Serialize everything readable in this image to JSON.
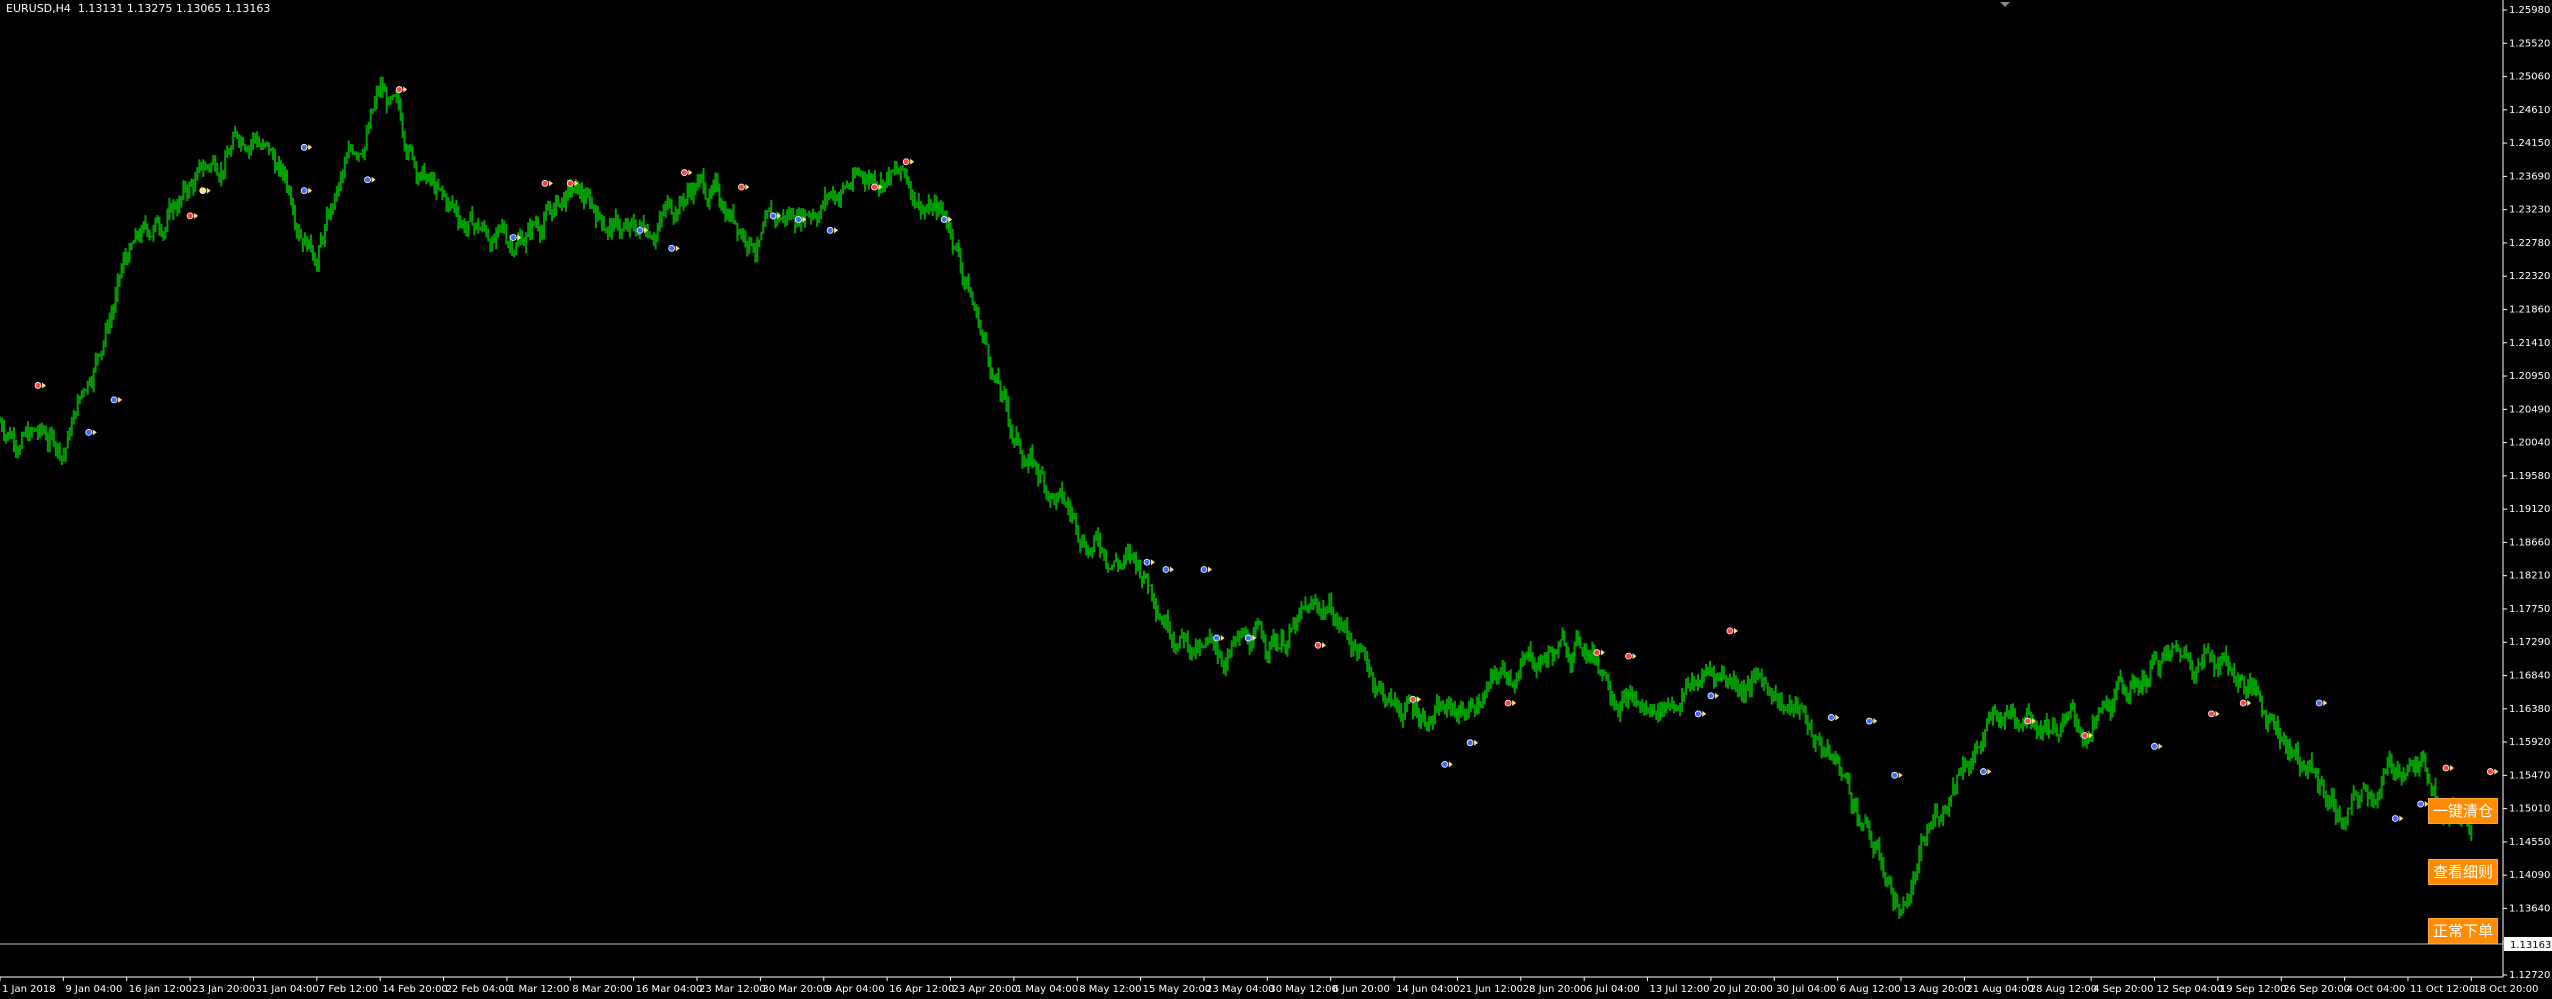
{
  "header": {
    "symbol": "EURUSD,H4",
    "ohlc": "1.13131 1.13275 1.13065 1.13163"
  },
  "price_tag": "1.13163",
  "buttons": {
    "close_all": "一键清仓",
    "view_details": "查看细则",
    "normal_order": "正常下单"
  },
  "colors": {
    "background": "#000000",
    "candles": "#00a000",
    "axis": "#ffffff",
    "button": "#ff8c00",
    "buy_marker": "#3a6dff",
    "sell_marker": "#ff4040",
    "close_marker": "#ffe07a"
  },
  "chart_data": {
    "type": "line",
    "title": "EURUSD,H4",
    "ylim": [
      1.1272,
      1.2598
    ],
    "yticks": [
      "1.25980",
      "1.25520",
      "1.25060",
      "1.24610",
      "1.24150",
      "1.23690",
      "1.23230",
      "1.22780",
      "1.22320",
      "1.21860",
      "1.21410",
      "1.20950",
      "1.20490",
      "1.20040",
      "1.19580",
      "1.19120",
      "1.18660",
      "1.18210",
      "1.17750",
      "1.17290",
      "1.16840",
      "1.16380",
      "1.15920",
      "1.15470",
      "1.15010",
      "1.14550",
      "1.14090",
      "1.13640",
      "1.13163",
      "1.12720"
    ],
    "xticks": [
      "1 Jan 2018",
      "9 Jan 04:00",
      "16 Jan 12:00",
      "23 Jan 20:00",
      "31 Jan 04:00",
      "7 Feb 12:00",
      "14 Feb 20:00",
      "22 Feb 04:00",
      "1 Mar 12:00",
      "8 Mar 20:00",
      "16 Mar 04:00",
      "23 Mar 12:00",
      "30 Mar 20:00",
      "9 Apr 04:00",
      "16 Apr 12:00",
      "23 Apr 20:00",
      "1 May 04:00",
      "8 May 12:00",
      "15 May 20:00",
      "23 May 04:00",
      "30 May 12:00",
      "6 Jun 20:00",
      "14 Jun 04:00",
      "21 Jun 12:00",
      "28 Jun 20:00",
      "6 Jul 04:00",
      "13 Jul 12:00",
      "20 Jul 20:00",
      "30 Jul 04:00",
      "6 Aug 12:00",
      "13 Aug 20:00",
      "21 Aug 04:00",
      "28 Aug 12:00",
      "4 Sep 20:00",
      "12 Sep 04:00",
      "19 Sep 12:00",
      "26 Sep 20:00",
      "4 Oct 04:00",
      "11 Oct 12:00",
      "18 Oct 20:00"
    ],
    "series": [
      {
        "x": [
          0,
          1,
          2,
          3,
          4,
          5,
          6,
          7,
          8,
          9,
          10,
          11,
          12,
          13,
          14,
          15,
          16,
          17,
          18,
          19,
          20,
          21,
          22,
          23,
          24,
          25,
          26,
          27,
          28,
          29,
          30,
          31,
          32,
          33,
          34,
          35,
          36,
          37,
          38,
          39
        ],
        "values": [
          1.2025,
          1.199,
          1.225,
          1.235,
          1.244,
          1.227,
          1.248,
          1.232,
          1.227,
          1.234,
          1.228,
          1.236,
          1.228,
          1.234,
          1.238,
          1.23,
          1.2,
          1.188,
          1.182,
          1.17,
          1.172,
          1.177,
          1.163,
          1.162,
          1.169,
          1.172,
          1.162,
          1.168,
          1.166,
          1.155,
          1.135,
          1.157,
          1.164,
          1.159,
          1.169,
          1.171,
          1.16,
          1.147,
          1.156,
          1.148
        ]
      }
    ],
    "markers": [
      {
        "x": 0.6,
        "y": 1.2075,
        "kind": "sell"
      },
      {
        "x": 1.4,
        "y": 1.201,
        "kind": "buy"
      },
      {
        "x": 1.8,
        "y": 1.2055,
        "kind": "buy"
      },
      {
        "x": 3.0,
        "y": 1.231,
        "kind": "sell"
      },
      {
        "x": 3.2,
        "y": 1.2345,
        "kind": "close"
      },
      {
        "x": 4.8,
        "y": 1.2405,
        "kind": "buy"
      },
      {
        "x": 4.8,
        "y": 1.2345,
        "kind": "buy"
      },
      {
        "x": 5.8,
        "y": 1.236,
        "kind": "buy"
      },
      {
        "x": 6.3,
        "y": 1.2485,
        "kind": "sell"
      },
      {
        "x": 8.1,
        "y": 1.228,
        "kind": "buy"
      },
      {
        "x": 8.6,
        "y": 1.2355,
        "kind": "sell"
      },
      {
        "x": 9.0,
        "y": 1.2355,
        "kind": "sell"
      },
      {
        "x": 10.1,
        "y": 1.229,
        "kind": "buy"
      },
      {
        "x": 10.6,
        "y": 1.2265,
        "kind": "buy"
      },
      {
        "x": 10.8,
        "y": 1.237,
        "kind": "sell"
      },
      {
        "x": 11.7,
        "y": 1.235,
        "kind": "sell"
      },
      {
        "x": 12.2,
        "y": 1.231,
        "kind": "buy"
      },
      {
        "x": 12.6,
        "y": 1.2305,
        "kind": "buy"
      },
      {
        "x": 13.1,
        "y": 1.229,
        "kind": "buy"
      },
      {
        "x": 13.8,
        "y": 1.235,
        "kind": "sell"
      },
      {
        "x": 14.3,
        "y": 1.2385,
        "kind": "sell"
      },
      {
        "x": 14.9,
        "y": 1.2305,
        "kind": "buy"
      },
      {
        "x": 18.1,
        "y": 1.183,
        "kind": "buy"
      },
      {
        "x": 18.4,
        "y": 1.182,
        "kind": "buy"
      },
      {
        "x": 19.0,
        "y": 1.182,
        "kind": "buy"
      },
      {
        "x": 19.2,
        "y": 1.1725,
        "kind": "buy"
      },
      {
        "x": 19.7,
        "y": 1.1725,
        "kind": "buy"
      },
      {
        "x": 20.8,
        "y": 1.1715,
        "kind": "sell"
      },
      {
        "x": 22.3,
        "y": 1.164,
        "kind": "sell"
      },
      {
        "x": 22.8,
        "y": 1.155,
        "kind": "buy"
      },
      {
        "x": 23.2,
        "y": 1.158,
        "kind": "buy"
      },
      {
        "x": 23.8,
        "y": 1.1635,
        "kind": "sell"
      },
      {
        "x": 25.2,
        "y": 1.1705,
        "kind": "sell"
      },
      {
        "x": 25.7,
        "y": 1.17,
        "kind": "sell"
      },
      {
        "x": 26.8,
        "y": 1.162,
        "kind": "buy"
      },
      {
        "x": 27.0,
        "y": 1.1645,
        "kind": "buy"
      },
      {
        "x": 27.3,
        "y": 1.1735,
        "kind": "sell"
      },
      {
        "x": 28.9,
        "y": 1.1615,
        "kind": "buy"
      },
      {
        "x": 29.5,
        "y": 1.161,
        "kind": "buy"
      },
      {
        "x": 29.9,
        "y": 1.1535,
        "kind": "buy"
      },
      {
        "x": 31.3,
        "y": 1.154,
        "kind": "buy"
      },
      {
        "x": 32.0,
        "y": 1.161,
        "kind": "sell"
      },
      {
        "x": 32.9,
        "y": 1.159,
        "kind": "sell"
      },
      {
        "x": 34.0,
        "y": 1.1575,
        "kind": "buy"
      },
      {
        "x": 34.9,
        "y": 1.162,
        "kind": "sell"
      },
      {
        "x": 35.4,
        "y": 1.1635,
        "kind": "sell"
      },
      {
        "x": 36.6,
        "y": 1.1635,
        "kind": "buy"
      },
      {
        "x": 37.8,
        "y": 1.1475,
        "kind": "buy"
      },
      {
        "x": 38.2,
        "y": 1.1495,
        "kind": "buy"
      },
      {
        "x": 38.6,
        "y": 1.1545,
        "kind": "sell"
      },
      {
        "x": 39.3,
        "y": 1.154,
        "kind": "sell"
      }
    ]
  }
}
